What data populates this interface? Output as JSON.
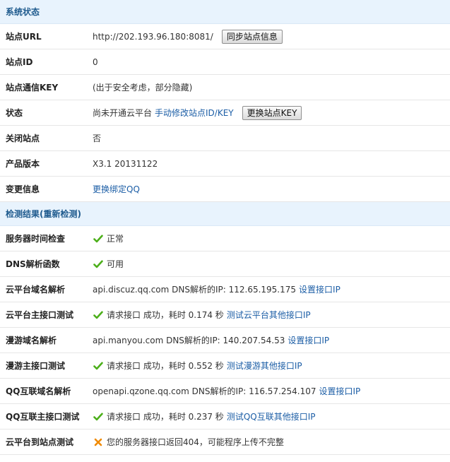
{
  "status_section": {
    "title": "系统状态",
    "site_url": {
      "label": "站点URL",
      "value": "http://202.193.96.180:8081/",
      "button": "同步站点信息"
    },
    "site_id": {
      "label": "站点ID",
      "value": "0"
    },
    "site_key": {
      "label": "站点通信KEY",
      "value": "(出于安全考虑，部分隐藏)"
    },
    "state": {
      "label": "状态",
      "value": "尚未开通云平台",
      "link": "手动修改站点ID/KEY",
      "button": "更换站点KEY"
    },
    "closed": {
      "label": "关闭站点",
      "value": "否"
    },
    "version": {
      "label": "产品版本",
      "value": "X3.1 20131122"
    },
    "change": {
      "label": "变更信息",
      "link": "更换绑定QQ"
    }
  },
  "check_section": {
    "title": "检测结果(重新检测)",
    "rows": [
      {
        "label": "服务器时间检查",
        "icon": "check-icon",
        "text": "正常"
      },
      {
        "label": "DNS解析函数",
        "icon": "check-icon",
        "text": "可用"
      },
      {
        "label": "云平台域名解析",
        "text": "api.discuz.qq.com DNS解析的IP:  112.65.195.175",
        "link": "设置接口IP"
      },
      {
        "label": "云平台主接口测试",
        "icon": "check-icon",
        "text": "请求接口 成功，耗时 0.174 秒",
        "link": "测试云平台其他接口IP"
      },
      {
        "label": "漫游域名解析",
        "text": "api.manyou.com DNS解析的IP:  140.207.54.53",
        "link": "设置接口IP"
      },
      {
        "label": "漫游主接口测试",
        "icon": "check-icon",
        "text": "请求接口 成功，耗时 0.552 秒",
        "link": "测试漫游其他接口IP"
      },
      {
        "label": "QQ互联域名解析",
        "text": "openapi.qzone.qq.com DNS解析的IP:  116.57.254.107",
        "link": "设置接口IP"
      },
      {
        "label": "QQ互联主接口测试",
        "icon": "check-icon",
        "text": "请求接口 成功，耗时 0.237 秒",
        "link": "测试QQ互联其他接口IP"
      },
      {
        "label": "云平台到站点测试",
        "icon": "cross-icon",
        "text": "您的服务器接口返回404，可能程序上传不完整"
      }
    ]
  },
  "colors": {
    "header_bg": "#e8f3fd",
    "header_text": "#1f5b8e",
    "link": "#1c5ea6",
    "check": "#4caf1a",
    "cross": "#f08a00"
  }
}
